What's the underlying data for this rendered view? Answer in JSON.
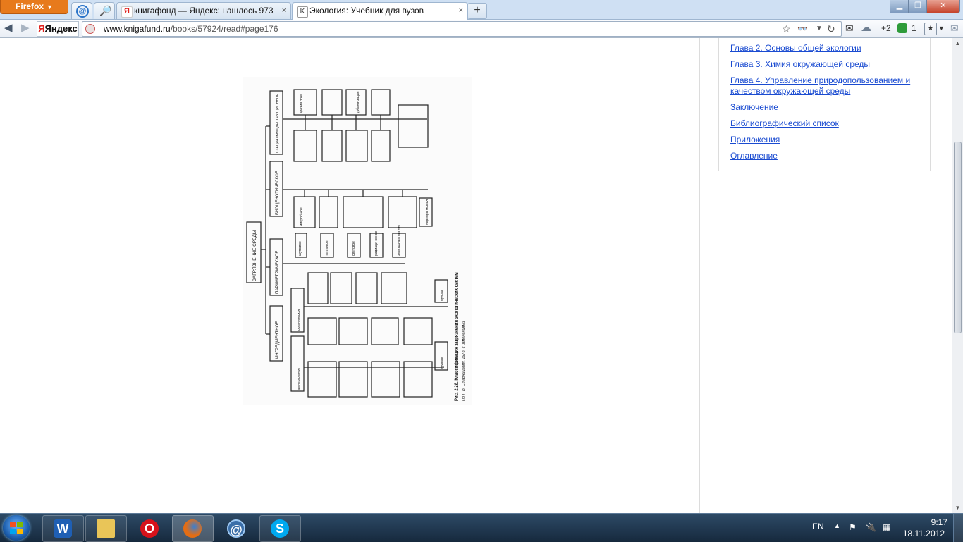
{
  "browser": {
    "menu_button": "Firefox",
    "tabs": [
      {
        "title": "книгафонд — Яндекс: нашлось 973 ...",
        "close": "×"
      },
      {
        "title": "Экология: Учебник для вузов",
        "close": "×"
      }
    ],
    "new_tab": "+",
    "search_brand": "Яндекс",
    "url_domain": "www.knigafund.ru",
    "url_path": "/books/57924/read#page176",
    "toolbar_weather": "+2",
    "toolbar_count": "1"
  },
  "sidebar_toc": {
    "links": [
      "Глава 2. Основы общей экологии",
      "Глава 3. Химия окружающей среды",
      "Глава 4. Управление природопользованием и качеством окружающей среды",
      "Заключение",
      "Библиографический список",
      "Приложения",
      "Оглавление"
    ]
  },
  "book_figure": {
    "root": "ЗАГРЯЗНЕНИЕ СРЕДЫ",
    "branches": [
      "ИНГРЕДИЕНТНОЕ",
      "ПАРАМЕТРИЧЕСКОЕ",
      "БИОЦЕНОТИЧЕСКОЕ",
      "СТАЦИАЛЬНО-ДЕСТРУКЦИОННОЕ"
    ],
    "caption": "Рис. 2.28. Классификация загрязнения экологических систем",
    "source": "По Г. В. Стадницкому, 1978, с изменениями",
    "stadial_top": [
      "эрозия почв",
      "осушение земель",
      "урбани-зация",
      "лесные и степные пожары"
    ],
    "stadial_bottom": [
      "вырубка лесных насаж-дений",
      "зарегули-рование водотоков",
      "карьерная разработ-ка иско-паемых",
      "дорожное строи-тельство"
    ],
    "stadial_other": "прочие формы, связанные с разрушением и преобразова-нием экосистем",
    "biocenotic": [
      "микроб-ное",
      "нарушение баланса популяции",
      "случайная и направ-ленная инт-родукция и акклима-тизация видов",
      "нерегули-руемый сбор, отлов, бра-коньерство",
      "перепро-мысел"
    ],
    "parametric": [
      "шумовое",
      "тепловое",
      "световое",
      "радиаци-онное",
      "электро-магнитное"
    ],
    "organic_label": "органическое",
    "organic": [
      "бытовые стоки и мусор",
      "микробио-логические препараты",
      "отходы пищевой промыш-ленности",
      "отходы животно-водческих ферм",
      "прочие"
    ],
    "mineral_label": "минеральное",
    "mineral_a": [
      "продукты сгорания в ДВС",
      "ядохими-каты и удобрения",
      "аварийные сбросы и выбросы на танкерах",
      "нефтедо-быча и нефтепе-реработка"
    ],
    "mineral_b": [
      "продукты сгорания ископае-мого топлива",
      "отходы химичес-ких про-изводств",
      "шахтные отвалы и терри-коники",
      "отходы метал-лургии"
    ],
    "mineral_other": "прочие"
  },
  "taskbar": {
    "lang": "EN",
    "time": "9:17",
    "date": "18.11.2012",
    "apps": [
      "word",
      "explorer",
      "opera",
      "firefox",
      "browser",
      "skype"
    ]
  },
  "colors": {
    "link": "#1a4bd1",
    "firefox_orange": "#e77a1c",
    "taskbar": "#1e3550"
  }
}
